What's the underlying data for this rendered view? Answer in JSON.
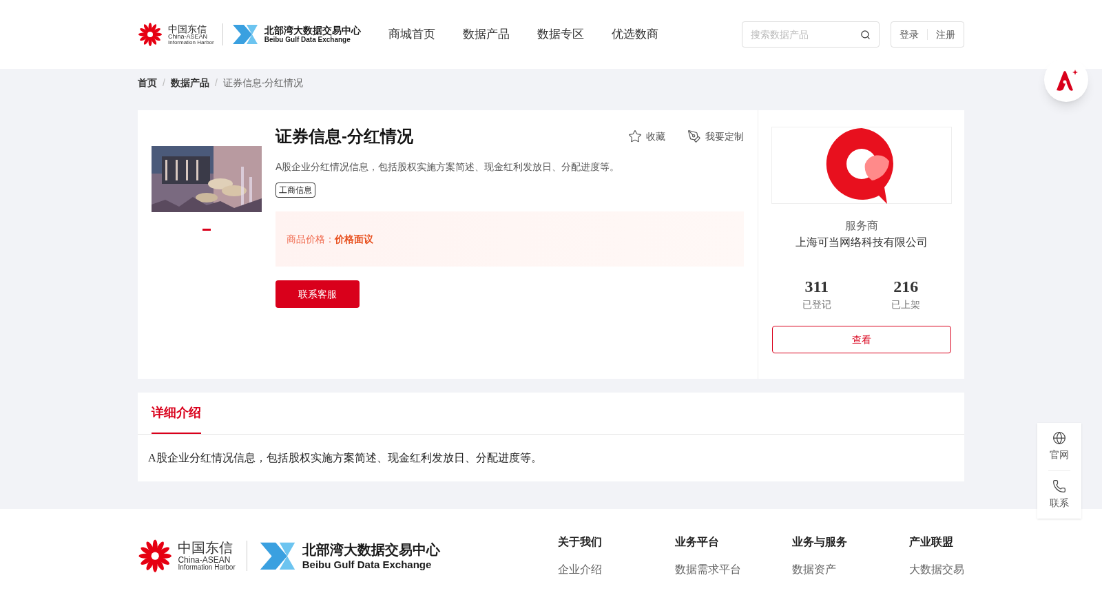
{
  "header": {
    "logo": {
      "cn": "中国东信",
      "en1": "China-ASEAN",
      "en2": "Information Harbor",
      "bx_cn": "北部湾大数据交易中心",
      "bx_en": "Beibu Gulf Data Exchange"
    },
    "nav": [
      {
        "label": "商城首页",
        "selected": false
      },
      {
        "label": "数据产品",
        "selected": false
      },
      {
        "label": "数据专区",
        "selected": false
      },
      {
        "label": "优选数商",
        "selected": false
      }
    ],
    "search": {
      "placeholder": "搜索数据产品"
    },
    "auth": [
      "登录",
      "注册"
    ]
  },
  "breadcrumb": {
    "items": [
      "首页",
      "数据产品",
      "证券信息-分红情况"
    ],
    "separators": [
      "/",
      "/"
    ]
  },
  "product": {
    "image": {
      "kind": "picture"
    },
    "carousel": [
      {
        "selected": true
      }
    ],
    "title": "证券信息-分红情况",
    "actions": [
      "收藏",
      "我要定制"
    ],
    "description": "A股企业分红情况信息，包括股权实施方案简述、现金红利发放日、分配进度等。",
    "tags": [
      "工商信息"
    ],
    "price_label": "商品价格：",
    "price_value": "价格面议",
    "contact_button": "联系客服"
  },
  "provider": {
    "role": "服务商",
    "name": "上海可当网络科技有限公司",
    "stats": [
      {
        "value": "311",
        "label": "已登记"
      },
      {
        "value": "216",
        "label": "已上架"
      }
    ],
    "view_button": "查看"
  },
  "details": {
    "tabs": [
      {
        "label": "详细介绍",
        "selected": true
      }
    ],
    "text": "A股企业分红情况信息，包括股权实施方案简述、现金红利发放日、分配进度等。"
  },
  "side_tools": [
    {
      "kind": "globe",
      "label": "官网"
    },
    {
      "kind": "phone",
      "label": "联系"
    }
  ],
  "footer": {
    "logo": {
      "cn": "中国东信",
      "en1": "China-ASEAN",
      "en2": "Information Harbor",
      "bx_cn": "北部湾大数据交易中心",
      "bx_en": "Beibu Gulf Data Exchange"
    },
    "columns": [
      {
        "title": "关于我们",
        "links": [
          "企业介绍"
        ]
      },
      {
        "title": "业务平台",
        "links": [
          "数据需求平台"
        ]
      },
      {
        "title": "业务与服务",
        "links": [
          "数据资产"
        ]
      },
      {
        "title": "产业联盟",
        "links": [
          "大数据交易"
        ]
      }
    ]
  }
}
